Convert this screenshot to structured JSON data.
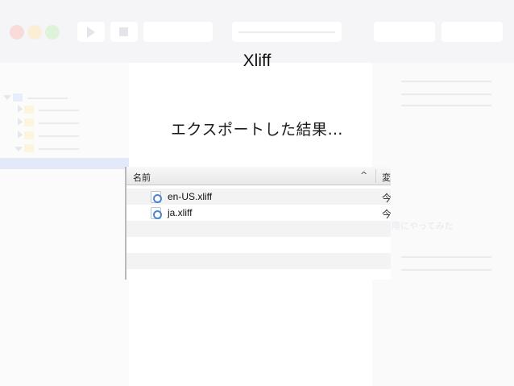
{
  "slide": {
    "title": "Xliff",
    "subtitle": "エクスポートした結果…"
  },
  "finder": {
    "columns": {
      "name": "名前",
      "modified": "変"
    },
    "sort_indicator": "^",
    "files": [
      {
        "name": "en-US.xliff",
        "modified": "今",
        "icon": "xliff-file-icon"
      },
      {
        "name": "ja.xliff",
        "modified": "今",
        "icon": "xliff-file-icon"
      }
    ]
  },
  "background": {
    "faded_text": "際にやってみた"
  }
}
